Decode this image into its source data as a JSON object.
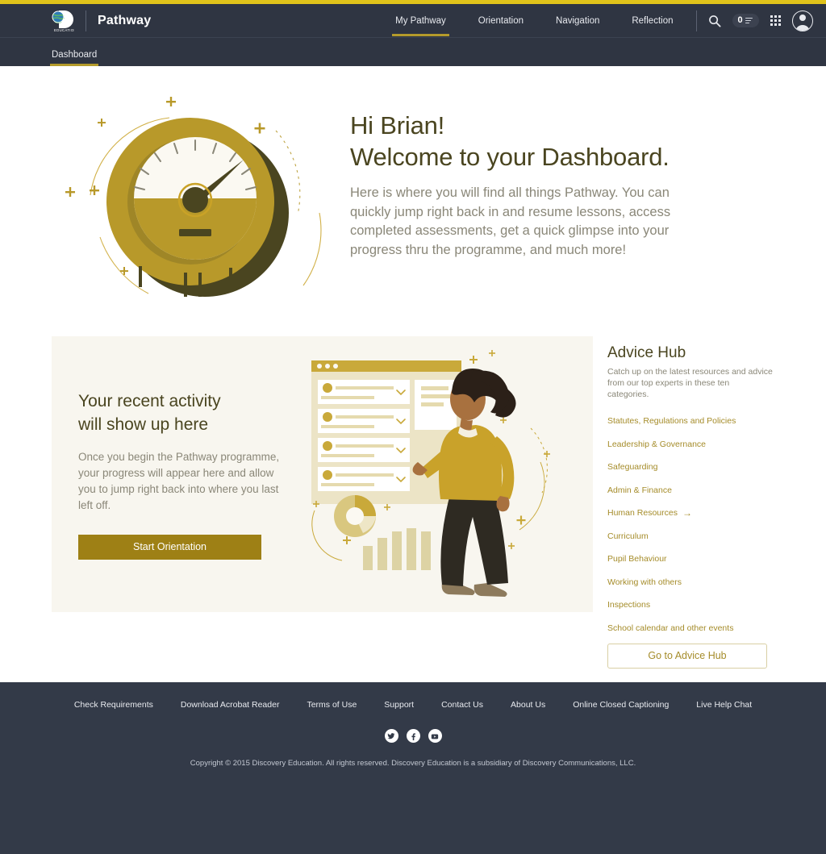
{
  "header": {
    "brand_name": "Pathway",
    "logo_alt": "Discovery Education",
    "nav": [
      {
        "label": "My Pathway",
        "active": true
      },
      {
        "label": "Orientation",
        "active": false
      },
      {
        "label": "Navigation",
        "active": false
      },
      {
        "label": "Reflection",
        "active": false
      }
    ],
    "search_icon": "search-icon",
    "queue_count": "0",
    "apps_icon": "apps-grid-icon",
    "avatar_icon": "user-avatar-icon"
  },
  "subnav": {
    "items": [
      {
        "label": "Dashboard",
        "active": true
      }
    ]
  },
  "hero": {
    "greeting": "Hi Brian!",
    "title": "Welcome to your Dashboard.",
    "description": "Here is where you will find all things Pathway. You can quickly jump right back in and resume lessons, access completed assessments, get a quick glimpse into your progress thru the programme, and much more!",
    "illustration": "speedometer-gauge-illustration"
  },
  "activity": {
    "title_line1": "Your recent activity",
    "title_line2": "will show up here",
    "body": "Once you begin the Pathway programme, your progress will appear here and allow you to jump right back into where you last left off.",
    "button_label": "Start Orientation",
    "illustration": "woman-with-dashboard-illustration"
  },
  "advice": {
    "title": "Advice Hub",
    "description": "Catch up on the latest resources and advice from our top experts in  these ten categories.",
    "categories": [
      {
        "label": "Statutes, Regulations and Policies",
        "has_arrow": false
      },
      {
        "label": "Leadership & Governance",
        "has_arrow": false
      },
      {
        "label": "Safeguarding",
        "has_arrow": false
      },
      {
        "label": "Admin & Finance",
        "has_arrow": false
      },
      {
        "label": "Human Resources",
        "has_arrow": true
      },
      {
        "label": "Curriculum",
        "has_arrow": false
      },
      {
        "label": "Pupil Behaviour",
        "has_arrow": false
      },
      {
        "label": "Working with others",
        "has_arrow": false
      },
      {
        "label": "Inspections",
        "has_arrow": false
      },
      {
        "label": "School calendar and other events",
        "has_arrow": false
      }
    ],
    "arrow_glyph": "→",
    "button_label": "Go to Advice Hub"
  },
  "footer": {
    "links": [
      "Check Requirements",
      "Download Acrobat Reader",
      "Terms of Use",
      "Support",
      "Contact Us",
      "About Us",
      "Online Closed Captioning",
      "Live Help Chat"
    ],
    "social": [
      "twitter-icon",
      "facebook-icon",
      "youtube-icon"
    ],
    "copyright": "Copyright © 2015 Discovery Education. All rights reserved. Discovery Education is a subsidiary of Discovery Communications, LLC."
  },
  "colors": {
    "top_rule": "#e0c31a",
    "header_bg": "#2f3542",
    "accent_gold": "#9e8015",
    "link_gold": "#a58c2a",
    "heading_olive": "#4a4520",
    "card_bg": "#f8f6ef",
    "footer_bg": "#333a48"
  }
}
